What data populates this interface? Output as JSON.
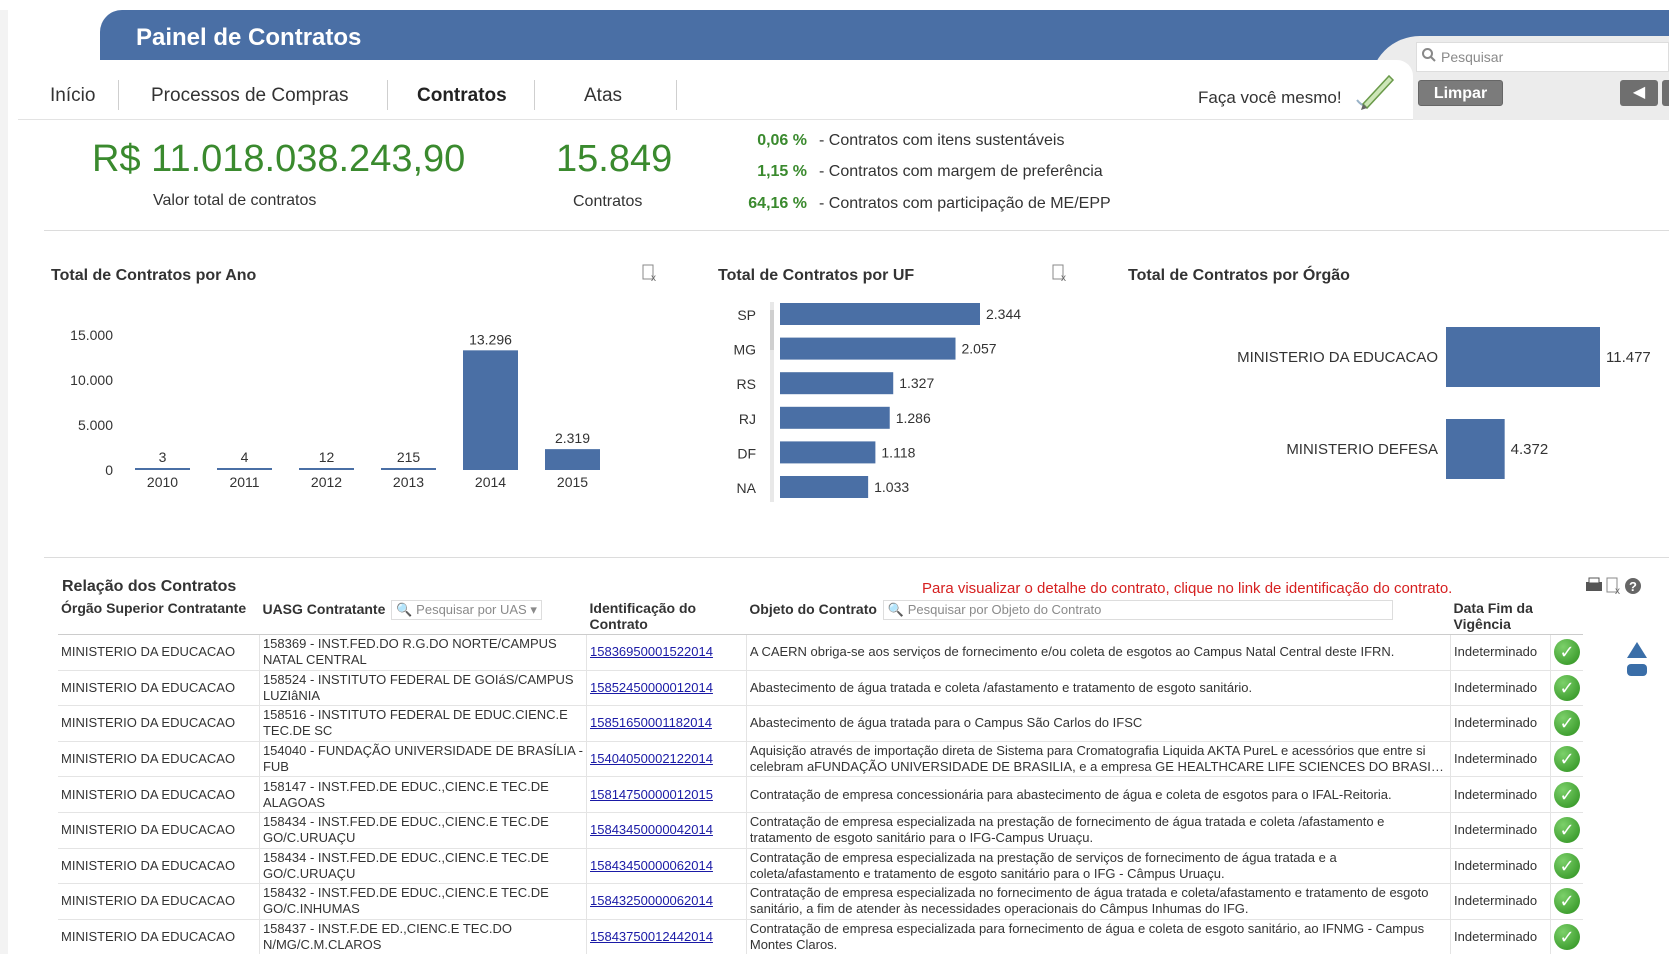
{
  "app": {
    "title": "Painel de Contratos"
  },
  "nav": {
    "tabs": [
      "Início",
      "Processos de Compras",
      "Contratos",
      "Atas"
    ],
    "active_tab": "Contratos",
    "diy_label": "Faça você mesmo!"
  },
  "toolbar": {
    "search_placeholder": "Pesquisar",
    "clear_label": "Limpar",
    "back_label": "◀"
  },
  "kpis": {
    "total_value": "R$ 11.018.038.243,90",
    "total_value_label": "Valor total de contratos",
    "count": "15.849",
    "count_label": "Contratos",
    "lines": [
      {
        "pct": "0,06 %",
        "text": "- Contratos com itens sustentáveis"
      },
      {
        "pct": "1,15 %",
        "text": "- Contratos com margem de preferência"
      },
      {
        "pct": "64,16 %",
        "text": "- Contratos com participação de ME/EPP"
      }
    ]
  },
  "charts": {
    "by_year_title": "Total de Contratos por Ano",
    "by_uf_title": "Total de Contratos por UF",
    "by_org_title": "Total de Contratos por Órgão"
  },
  "chart_data": [
    {
      "type": "bar",
      "title": "Total de Contratos por Ano",
      "categories": [
        "2010",
        "2011",
        "2012",
        "2013",
        "2014",
        "2015"
      ],
      "values": [
        3,
        4,
        12,
        215,
        13296,
        2319
      ],
      "value_labels": [
        "3",
        "4",
        "12",
        "215",
        "13.296",
        "2.319"
      ],
      "yticks": [
        "0",
        "5.000",
        "10.000",
        "15.000"
      ],
      "ylim": [
        0,
        15000
      ],
      "bar_color": "#4a6fa5"
    },
    {
      "type": "bar",
      "orientation": "horizontal",
      "title": "Total de Contratos por UF",
      "categories": [
        "SP",
        "MG",
        "RS",
        "RJ",
        "DF",
        "NA"
      ],
      "values": [
        2344,
        2057,
        1327,
        1286,
        1118,
        1033
      ],
      "value_labels": [
        "2.344",
        "2.057",
        "1.327",
        "1.286",
        "1.118",
        "1.033"
      ],
      "xlim": [
        0,
        2344
      ],
      "bar_color": "#4a6fa5"
    },
    {
      "type": "bar",
      "orientation": "horizontal",
      "title": "Total de Contratos por Órgão",
      "categories": [
        "MINISTERIO DA EDUCACAO",
        "MINISTERIO DEFESA"
      ],
      "values": [
        11477,
        4372
      ],
      "value_labels": [
        "11.477",
        "4.372"
      ],
      "xlim": [
        0,
        11477
      ],
      "bar_color": "#4a6fa5"
    }
  ],
  "table": {
    "heading": "Relação dos Contratos",
    "hint": "Para visualizar o detalhe do contrato, clique no link de identificação do contrato.",
    "columns": [
      "Órgão Superior Contratante",
      "UASG Contratante",
      "Identificação do Contrato",
      "Objeto do Contrato",
      "Data Fim da Vigência"
    ],
    "uasg_search_placeholder": "Pesquisar por UAS",
    "objeto_search_placeholder": "Pesquisar por Objeto do Contrato",
    "rows": [
      [
        "MINISTERIO DA EDUCACAO",
        "158369 - INST.FED.DO R.G.DO NORTE/CAMPUS NATAL CENTRAL",
        "15836950001522014",
        "A CAERN obriga-se aos serviços de fornecimento e/ou coleta de esgotos ao Campus Natal Central deste IFRN.",
        "Indeterminado"
      ],
      [
        "MINISTERIO DA EDUCACAO",
        "158524 - INSTITUTO FEDERAL DE GOIáS/CAMPUS LUZIâNIA",
        "15852450000012014",
        "Abastecimento de água tratada e coleta /afastamento e tratamento de esgoto sanitário.",
        "Indeterminado"
      ],
      [
        "MINISTERIO DA EDUCACAO",
        "158516 - INSTITUTO FEDERAL DE EDUC.CIENC.E TEC.DE SC",
        "15851650001182014",
        "Abastecimento de água tratada para o Campus São Carlos do IFSC",
        "Indeterminado"
      ],
      [
        "MINISTERIO DA EDUCACAO",
        "154040 - FUNDAÇÃO UNIVERSIDADE DE BRASÍLIA - FUB",
        "15404050002122014",
        "Aquisição através de importação direta de Sistema para Cromatografia Liquida AKTA PureL e acessórios que entre si celebram aFUNDAÇÃO UNIVERSIDADE DE BRASILIA, e a empresa GE HEALTHCARE LIFE SCIENCES DO BRASI…",
        "Indeterminado"
      ],
      [
        "MINISTERIO DA EDUCACAO",
        "158147 - INST.FED.DE EDUC.,CIENC.E TEC.DE ALAGOAS",
        "15814750000012015",
        "Contratação de empresa concessionária para abastecimento de água e coleta de esgotos para o IFAL-Reitoria.",
        "Indeterminado"
      ],
      [
        "MINISTERIO DA EDUCACAO",
        "158434 - INST.FED.DE EDUC.,CIENC.E TEC.DE GO/C.URUAÇU",
        "15843450000042014",
        "Contratação de empresa especializada na prestação de fornecimento de água tratada e coleta /afastamento e tratamento de esgoto sanitário para o IFG-Campus Uruaçu.",
        "Indeterminado"
      ],
      [
        "MINISTERIO DA EDUCACAO",
        "158434 - INST.FED.DE EDUC.,CIENC.E TEC.DE GO/C.URUAÇU",
        "15843450000062014",
        "Contratação de empresa especializada na prestação de serviços de fornecimento de água tratada e a coleta/afastamento e tratamento de esgoto sanitário para o IFG - Câmpus Uruaçu.",
        "Indeterminado"
      ],
      [
        "MINISTERIO DA EDUCACAO",
        "158432 - INST.FED.DE EDUC.,CIENC.E TEC.DE GO/C.INHUMAS",
        "15843250000062014",
        "Contratação de empresa especializada no fornecimento de água tratada e coleta/afastamento e tratamento de esgoto sanitário, a fim de atender às necessidades operacionais do Câmpus Inhumas do IFG.",
        "Indeterminado"
      ],
      [
        "MINISTERIO DA EDUCACAO",
        "158437 - INST.F.DE ED.,CIENC.E TEC.DO N/MG/C.M.CLAROS",
        "15843750012442014",
        "Contratação de empresa especializada para fornecimento de água e coleta de esgoto sanitário, ao IFNMG - Campus Montes Claros.",
        "Indeterminado"
      ]
    ]
  }
}
